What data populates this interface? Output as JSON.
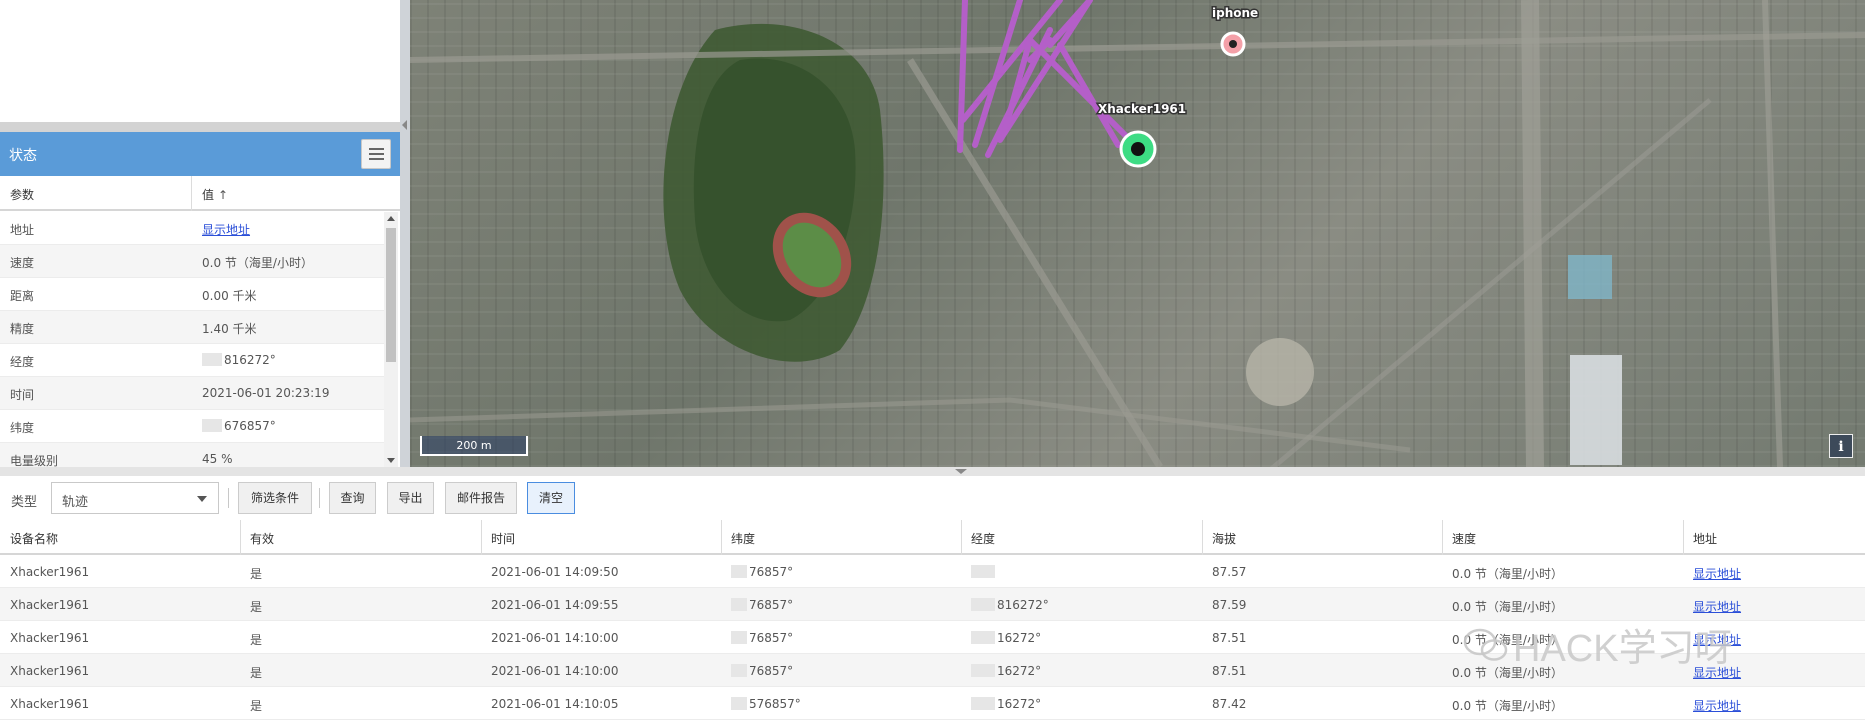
{
  "status_panel": {
    "title": "状态",
    "menu_icon": "list-menu-icon",
    "columns": {
      "param": "参数",
      "value": "值",
      "sort_icon": "sort-arrow-up-icon"
    },
    "rows": [
      {
        "param": "地址",
        "value": "显示地址",
        "is_link": true,
        "masked": false
      },
      {
        "param": "速度",
        "value": "0.0 节（海里/小时）",
        "is_link": false,
        "masked": false
      },
      {
        "param": "距离",
        "value": "0.00 千米",
        "is_link": false,
        "masked": false
      },
      {
        "param": "精度",
        "value": "1.40 千米",
        "is_link": false,
        "masked": false
      },
      {
        "param": "经度",
        "value": "816272°",
        "is_link": false,
        "masked": true
      },
      {
        "param": "时间",
        "value": "2021-06-01 20:23:19",
        "is_link": false,
        "masked": false
      },
      {
        "param": "纬度",
        "value": "676857°",
        "is_link": false,
        "masked": true
      },
      {
        "param": "电量级别",
        "value": "45 %",
        "is_link": false,
        "masked": false
      }
    ]
  },
  "map": {
    "markers": [
      {
        "label": "iphone",
        "color": "#f4a0a8"
      },
      {
        "label": "Xhacker1961",
        "color": "#3ddc84"
      }
    ],
    "track_color": "#b45fc8",
    "scale_label": "200 m",
    "info_label": "i"
  },
  "toolbar": {
    "type_label": "类型",
    "type_value": "轨迹",
    "buttons": {
      "filter": "筛选条件",
      "query": "查询",
      "export": "导出",
      "mail_report": "邮件报告",
      "clear": "清空"
    }
  },
  "table": {
    "columns": [
      "设备名称",
      "有效",
      "时间",
      "纬度",
      "经度",
      "海拔",
      "速度",
      "地址"
    ],
    "rows": [
      [
        "Xhacker1961",
        "是",
        "2021-06-01 14:09:50",
        "76857°",
        "",
        "87.57",
        "0.0 节（海里/小时）",
        "显示地址"
      ],
      [
        "Xhacker1961",
        "是",
        "2021-06-01 14:09:55",
        "76857°",
        "816272°",
        "87.59",
        "0.0 节（海里/小时）",
        "显示地址"
      ],
      [
        "Xhacker1961",
        "是",
        "2021-06-01 14:10:00",
        "76857°",
        "16272°",
        "87.51",
        "0.0 节（海里/小时）",
        "显示地址"
      ],
      [
        "Xhacker1961",
        "是",
        "2021-06-01 14:10:00",
        "76857°",
        "16272°",
        "87.51",
        "0.0 节（海里/小时）",
        "显示地址"
      ],
      [
        "Xhacker1961",
        "是",
        "2021-06-01 14:10:05",
        "576857°",
        "16272°",
        "87.42",
        "0.0 节（海里/小时）",
        "显示地址"
      ]
    ]
  },
  "watermark": "HACK学习呀"
}
